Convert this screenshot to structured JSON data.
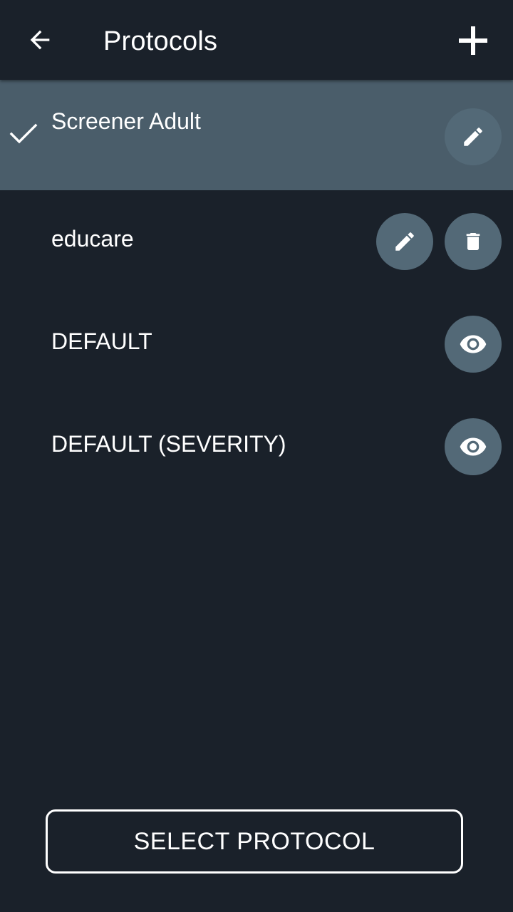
{
  "header": {
    "title": "Protocols",
    "back_icon": "arrow-left-icon",
    "add_icon": "plus-icon"
  },
  "protocols": [
    {
      "label": "Screener Adult",
      "selected": true,
      "actions": [
        "edit-icon"
      ]
    },
    {
      "label": "educare",
      "selected": false,
      "actions": [
        "edit-icon",
        "trash-icon"
      ]
    },
    {
      "label": "DEFAULT",
      "selected": false,
      "actions": [
        "eye-icon"
      ]
    },
    {
      "label": "DEFAULT (SEVERITY)",
      "selected": false,
      "actions": [
        "eye-icon"
      ]
    }
  ],
  "footer": {
    "select_button_label": "SELECT PROTOCOL"
  },
  "colors": {
    "background": "#1a212a",
    "selected_row": "#4a5d6a",
    "action_button": "#536977",
    "text": "#ffffff"
  }
}
